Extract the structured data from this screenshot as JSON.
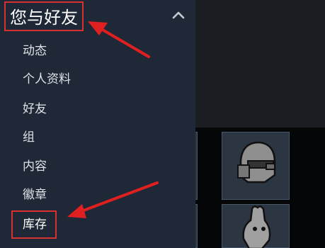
{
  "menu": {
    "title": "您与好友",
    "chevron_icon": "chevron-up-icon",
    "items": [
      {
        "label": "动态"
      },
      {
        "label": "个人资料"
      },
      {
        "label": "好友"
      },
      {
        "label": "组"
      },
      {
        "label": "内容"
      },
      {
        "label": "徽章"
      },
      {
        "label": "库存"
      }
    ]
  },
  "inventory": {
    "tiles": [
      {
        "icon": "item-fragment-icon"
      },
      {
        "icon": "knight-helmet-icon"
      },
      {
        "icon": "item-fragment-icon"
      },
      {
        "icon": "creature-head-icon"
      }
    ]
  },
  "annotations": {
    "highlight_color": "#d93030",
    "arrow_color": "#e02020"
  },
  "colors": {
    "menu_bg": "#1f2836",
    "tile_bg": "#2c3542",
    "tile_border": "#48566a"
  }
}
